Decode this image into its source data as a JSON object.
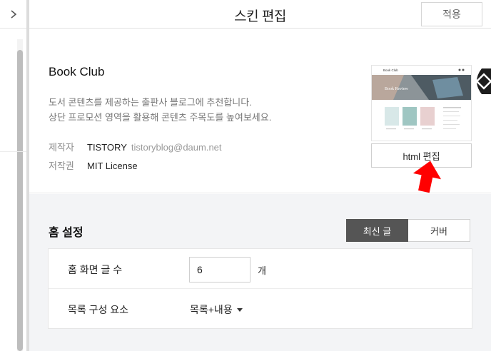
{
  "header": {
    "title": "스킨 편집",
    "apply_label": "적용",
    "collapse_icon": "chevron-right-icon"
  },
  "skin": {
    "name": "Book Club",
    "description_line1": "도서 콘텐츠를 제공하는 출판사 블로그에 추천합니다.",
    "description_line2": "상단 프로모션 영역을 활용해 콘텐츠 주목도를 높여보세요.",
    "author_label": "제작자",
    "author_value": "TISTORY",
    "author_email": "tistoryblog@daum.net",
    "license_label": "저작권",
    "license_value": "MIT License",
    "thumbnail_title": "Book Club",
    "thumbnail_banner": "Book Review",
    "html_edit_label": "html 편집"
  },
  "home": {
    "title": "홈 설정",
    "tabs": [
      {
        "label": "최신 글",
        "active": true
      },
      {
        "label": "커버",
        "active": false
      }
    ],
    "post_count_label": "홈 화면 글 수",
    "post_count_value": "6",
    "post_count_unit": "개",
    "list_component_label": "목록 구성 요소",
    "list_component_value": "목록+내용"
  },
  "colors": {
    "active_tab": "#555555",
    "arrow": "#ff0000",
    "section_bg": "#f3f4f6"
  }
}
